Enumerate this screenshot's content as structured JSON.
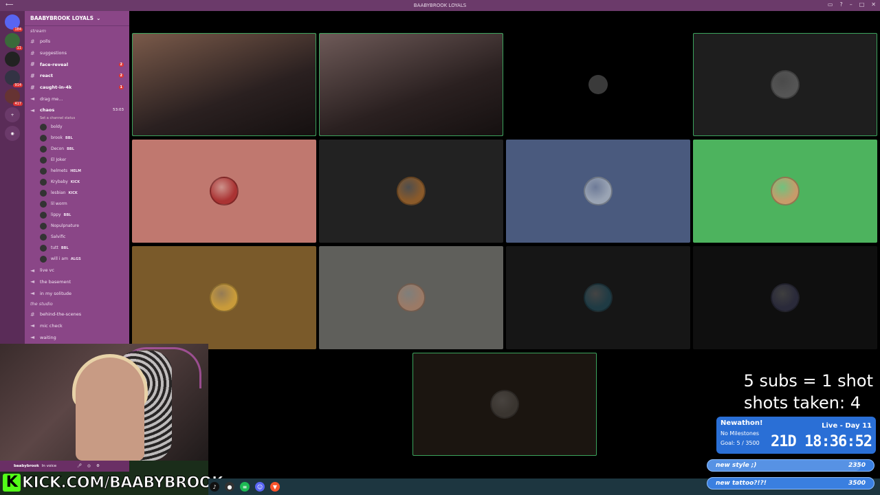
{
  "window": {
    "title": "BAABYBROOK LOYALS"
  },
  "servers": [
    {
      "label": "",
      "badge": "184"
    },
    {
      "label": "",
      "badge": "11"
    },
    {
      "label": "",
      "badge": ""
    },
    {
      "label": "",
      "badge": "914"
    },
    {
      "label": "",
      "badge": "417"
    }
  ],
  "sidebar": {
    "guild_name": "BAABYBROOK LOYALS",
    "category_top": "stream",
    "channels": [
      {
        "label": "polls",
        "type": "text",
        "count": ""
      },
      {
        "label": "suggestions",
        "type": "text",
        "count": ""
      },
      {
        "label": "face-reveal",
        "type": "text",
        "count": "2",
        "bold": true
      },
      {
        "label": "react",
        "type": "text",
        "count": "2",
        "bold": true
      },
      {
        "label": "caught-in-4k",
        "type": "text",
        "count": "1",
        "bold": true
      },
      {
        "label": "drag me...",
        "type": "voice",
        "count": ""
      },
      {
        "label": "chaos",
        "type": "voice",
        "count": "",
        "bold": true,
        "timer": "53:03"
      }
    ],
    "channel_status": "Set a channel status",
    "voice_users": [
      {
        "name": "boldy",
        "tag": ""
      },
      {
        "name": "brook",
        "tag": "BBL"
      },
      {
        "name": "Decon",
        "tag": "BBL"
      },
      {
        "name": "El Joker",
        "tag": ""
      },
      {
        "name": "helmets",
        "tag": "HELM"
      },
      {
        "name": "Krybaby",
        "tag": "KICK"
      },
      {
        "name": "lesbian",
        "tag": "KICK"
      },
      {
        "name": "lil worm",
        "tag": ""
      },
      {
        "name": "lippy",
        "tag": "BBL"
      },
      {
        "name": "Nopulpnature",
        "tag": ""
      },
      {
        "name": "Salvific",
        "tag": ""
      },
      {
        "name": "tutt",
        "tag": "BBL"
      },
      {
        "name": "will i am",
        "tag": "ALGS"
      }
    ],
    "more_channels": [
      {
        "label": "live vc",
        "type": "voice"
      },
      {
        "label": "the basement",
        "type": "voice"
      },
      {
        "label": "in my solitude",
        "type": "voice"
      }
    ],
    "category_studio": "the studio",
    "studio_channels": [
      {
        "label": "behind-the-scenes",
        "type": "text"
      },
      {
        "label": "mic check",
        "type": "voice"
      },
      {
        "label": "waiting",
        "type": "voice"
      }
    ]
  },
  "voice_status": {
    "user": "baabybrook",
    "status": "In voice"
  },
  "tiles": [
    {
      "kind": "video",
      "color": "#7a5a4a",
      "speaking": true
    },
    {
      "kind": "video",
      "color": "#6e5a58",
      "speaking": true
    },
    {
      "kind": "empty",
      "color": "#000000",
      "speaking": false
    },
    {
      "kind": "avatar",
      "color": "#1e1e1e",
      "avatar": "#555555",
      "speaking": true
    },
    {
      "kind": "avatar",
      "color": "#c0786f",
      "avatar": "#a33",
      "speaking": false
    },
    {
      "kind": "avatar",
      "color": "#222222",
      "avatar": "#8a5a2a",
      "speaking": false
    },
    {
      "kind": "avatar",
      "color": "#4a5a7e",
      "avatar": "#9aa4b4",
      "speaking": false
    },
    {
      "kind": "avatar",
      "color": "#4db35e",
      "avatar": "#c79b6a",
      "speaking": false
    },
    {
      "kind": "avatar",
      "color": "#7a5a2a",
      "avatar": "#c99b3a",
      "speaking": false
    },
    {
      "kind": "avatar",
      "color": "#5f5f5b",
      "avatar": "#9b7a66",
      "speaking": false
    },
    {
      "kind": "avatar",
      "color": "#161616",
      "avatar": "#1f3b44",
      "speaking": false
    },
    {
      "kind": "avatar",
      "color": "#0f0f0f",
      "avatar": "#2a2a3a",
      "speaking": false
    },
    {
      "kind": "avatar",
      "color": "#1b1510",
      "avatar": "#3a3530",
      "speaking": true
    }
  ],
  "overlay": {
    "subs_line": "5 subs = 1 shot",
    "shots_line": "shots taken: 4"
  },
  "newathon": {
    "title": "Newathon!",
    "milestones": "No Milestones",
    "goal": "Goal: 5 / 3500",
    "day": "Live - Day 11",
    "timer": "21D 18:36:52"
  },
  "goals": [
    {
      "label": "new style ;)",
      "value": "2350",
      "progress": 0.92
    },
    {
      "label": "new tattoo?!?!",
      "value": "3500",
      "progress": 0.0
    }
  ],
  "branding": {
    "kick": "KICK.COM/BAABYBROOK"
  },
  "colors": {
    "speaking": "#3ba55d",
    "sidebar": "#8a4687",
    "servers": "#5a2c58",
    "kick": "#53fc18"
  }
}
